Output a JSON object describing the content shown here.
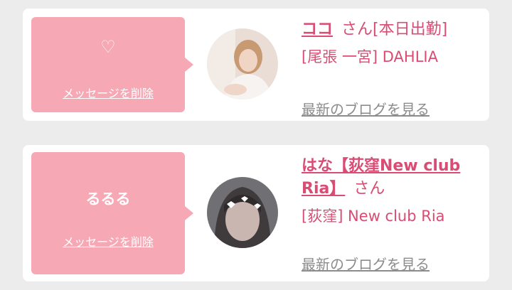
{
  "messages": [
    {
      "bubble_icon": "white-heart-icon",
      "bubble_text": "",
      "delete_label": "メッセージを削除",
      "name": "ココ",
      "honorific": "さん[本日出勤]",
      "location": "[尾張 一宮] DAHLIA",
      "blog_label": "最新のブログを見る"
    },
    {
      "bubble_icon": "",
      "bubble_text": "るるる",
      "delete_label": "メッセージを削除",
      "name_line1": "はな【荻窪New club",
      "name_line2": "Ria】",
      "honorific": "さん",
      "location": "[荻窪] New club Ria",
      "blog_label": "最新のブログを見る"
    }
  ],
  "colors": {
    "accent": "#d94c73",
    "bubble": "#f7a8b5",
    "link_gray": "#8c8c8c"
  }
}
